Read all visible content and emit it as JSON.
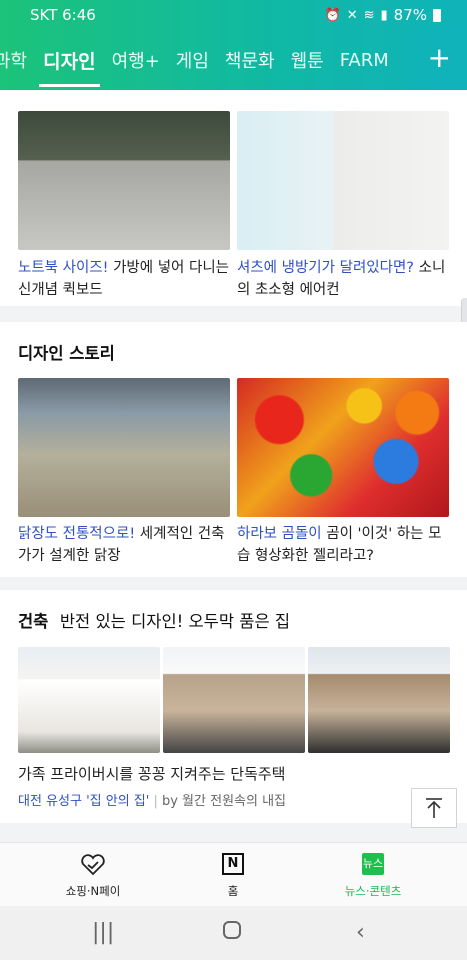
{
  "status": {
    "carrier": "SKT 6:46",
    "battery": "87%"
  },
  "tabs": [
    {
      "label": "과학"
    },
    {
      "label": "디자인"
    },
    {
      "label": "여행+"
    },
    {
      "label": "게임"
    },
    {
      "label": "책문화"
    },
    {
      "label": "웹툰"
    },
    {
      "label": "FARM"
    }
  ],
  "plus_label": "+",
  "card1": {
    "left": {
      "highlight": "노트북 사이즈!",
      "text": " 가방에 넣어 다니는 신개념 퀵보드"
    },
    "right": {
      "highlight": "셔츠에 냉방기가 달려있다면?",
      "text": " 소니의 초소형 에어컨"
    }
  },
  "card2": {
    "title": "디자인 스토리",
    "left": {
      "highlight": "닭장도 전통적으로!",
      "text": " 세계적인 건축가가 설계한 닭장"
    },
    "right": {
      "highlight": "하라보 곰돌이",
      "text": " 곰이 '이것' 하는 모습 형상화한 젤리라고?"
    }
  },
  "card3": {
    "tag": "건축",
    "title": "반전 있는 디자인! 오두막 품은 집",
    "headline": "가족 프라이버시를 꽁꽁 지켜주는 단독주택",
    "source_highlight": "대전 유성구 '집 안의 집'",
    "source_sep": " | ",
    "source_text": "by 월간 전원속의 내집"
  },
  "top_button_icon": "arrow-up-to-top-icon",
  "bottom_nav": [
    {
      "label": "쇼핑·N페이",
      "icon": "heart-check-icon"
    },
    {
      "label": "홈",
      "icon": "naver-n-icon",
      "glyph": "N"
    },
    {
      "label": "뉴스·콘텐츠",
      "icon": "news-icon",
      "glyph": "뉴스"
    }
  ],
  "colors": {
    "accent": "#18b84f",
    "link": "#2f51c4"
  }
}
